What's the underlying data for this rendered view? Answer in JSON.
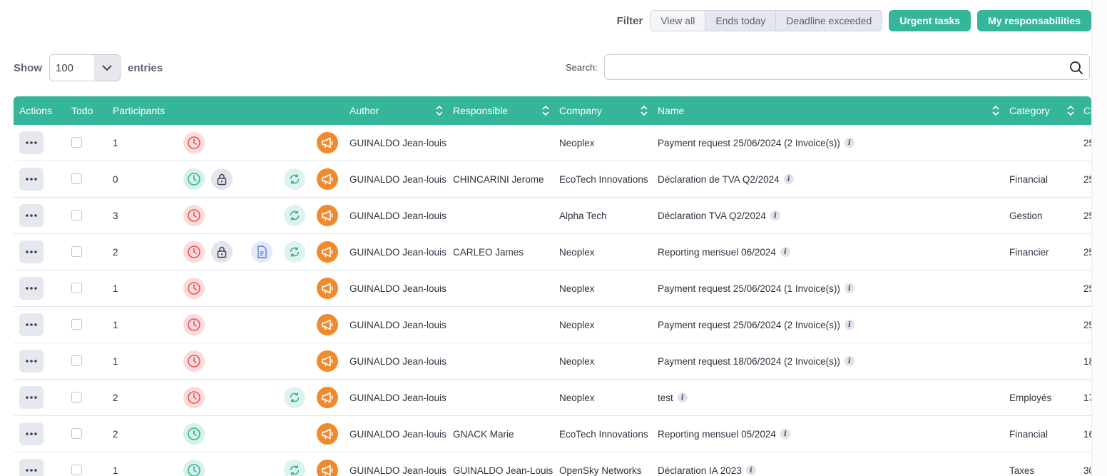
{
  "filter": {
    "label": "Filter",
    "segments": [
      "View all",
      "Ends today",
      "Deadline exceeded"
    ],
    "urgent_label": "Urgent tasks",
    "resp_label": "My responsabilities"
  },
  "entries": {
    "show_label": "Show",
    "value": "100",
    "entries_label": "entries"
  },
  "search": {
    "label": "Search:",
    "value": ""
  },
  "columns": {
    "actions": "Actions",
    "todo": "Todo",
    "participants": "Participants",
    "author": "Author",
    "responsible": "Responsible",
    "company": "Company",
    "name": "Name",
    "category": "Category",
    "c": "C"
  },
  "colors": {
    "header": "#35b59a",
    "megaphone": "#f28a2c"
  },
  "rows": [
    {
      "participants": "1",
      "clock": "red",
      "lock": false,
      "doc": false,
      "sync": false,
      "author": "GUINALDO Jean-louis",
      "responsible": "",
      "company": "Neoplex",
      "name": "Payment request 25/06/2024 (2 Invoice(s))",
      "category": "",
      "c": "25"
    },
    {
      "participants": "0",
      "clock": "green",
      "lock": true,
      "doc": false,
      "sync": true,
      "author": "GUINALDO Jean-louis",
      "responsible": "CHINCARINI Jerome",
      "company": "EcoTech Innovations",
      "name": "Déclaration de TVA Q2/2024",
      "category": "Financial",
      "c": "25"
    },
    {
      "participants": "3",
      "clock": "red",
      "lock": false,
      "doc": false,
      "sync": true,
      "author": "GUINALDO Jean-louis",
      "responsible": "",
      "company": "Alpha Tech",
      "name": "Déclaration TVA Q2/2024",
      "category": "Gestion",
      "c": "25"
    },
    {
      "participants": "2",
      "clock": "red",
      "lock": true,
      "doc": true,
      "sync": true,
      "author": "GUINALDO Jean-louis",
      "responsible": "CARLEO James",
      "company": "Neoplex",
      "name": "Reporting mensuel 06/2024",
      "category": "Financier",
      "c": "25"
    },
    {
      "participants": "1",
      "clock": "red",
      "lock": false,
      "doc": false,
      "sync": false,
      "author": "GUINALDO Jean-louis",
      "responsible": "",
      "company": "Neoplex",
      "name": "Payment request 25/06/2024 (1 Invoice(s))",
      "category": "",
      "c": "25"
    },
    {
      "participants": "1",
      "clock": "red",
      "lock": false,
      "doc": false,
      "sync": false,
      "author": "GUINALDO Jean-louis",
      "responsible": "",
      "company": "Neoplex",
      "name": "Payment request 25/06/2024 (2 Invoice(s))",
      "category": "",
      "c": "25"
    },
    {
      "participants": "1",
      "clock": "red",
      "lock": false,
      "doc": false,
      "sync": false,
      "author": "GUINALDO Jean-louis",
      "responsible": "",
      "company": "Neoplex",
      "name": "Payment request 18/06/2024 (2 Invoice(s))",
      "category": "",
      "c": "18"
    },
    {
      "participants": "2",
      "clock": "red",
      "lock": false,
      "doc": false,
      "sync": true,
      "author": "GUINALDO Jean-louis",
      "responsible": "",
      "company": "Neoplex",
      "name": "test",
      "category": "Employés",
      "c": "17"
    },
    {
      "participants": "2",
      "clock": "green",
      "lock": false,
      "doc": false,
      "sync": false,
      "author": "GUINALDO Jean-louis",
      "responsible": "GNACK Marie",
      "company": "EcoTech Innovations",
      "name": "Reporting mensuel 05/2024",
      "category": "Financial",
      "c": "16"
    },
    {
      "participants": "1",
      "clock": "green",
      "lock": false,
      "doc": false,
      "sync": true,
      "author": "GUINALDO Jean-louis",
      "responsible": "GUINALDO Jean-Louis",
      "company": "OpenSky Networks",
      "name": "Déclaration IA 2023",
      "category": "Taxes",
      "c": "30"
    }
  ]
}
